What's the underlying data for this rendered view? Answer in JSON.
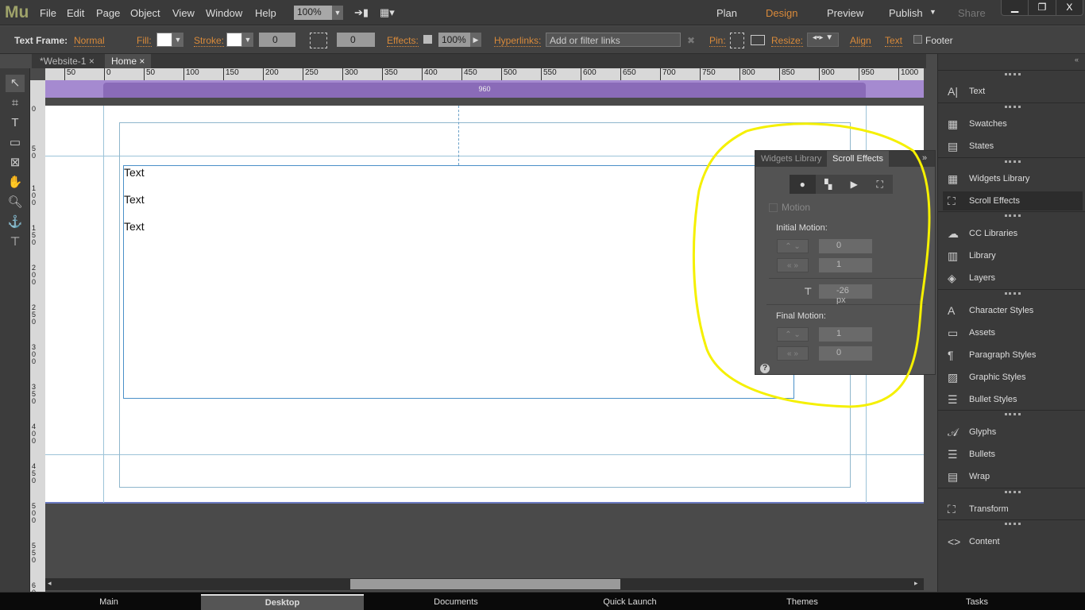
{
  "app": {
    "logo": "Mu",
    "menu": [
      "File",
      "Edit",
      "Page",
      "Object",
      "View",
      "Window",
      "Help"
    ],
    "zoom": "100%",
    "modes": [
      "Plan",
      "Design",
      "Preview",
      "Publish",
      "Share"
    ],
    "active_mode": "Design",
    "window_buttons": [
      "▁",
      "❐",
      "X"
    ]
  },
  "control": {
    "frame_label": "Text Frame:",
    "frame_style": "Normal",
    "fill": "Fill:",
    "stroke": "Stroke:",
    "stroke_width": "0",
    "corner": "0",
    "effects": "Effects:",
    "opacity": "100%",
    "hyperlinks": "Hyperlinks:",
    "links_placeholder": "Add or filter links",
    "pin": "Pin:",
    "resize": "Resize:",
    "align": "Align",
    "text": "Text",
    "footer": "Footer"
  },
  "tabs": [
    {
      "label": "*Website-1"
    },
    {
      "label": "Home"
    }
  ],
  "ruler": {
    "h": [
      "50",
      "0",
      "50",
      "100",
      "150",
      "200",
      "250",
      "300",
      "350",
      "400",
      "450",
      "500",
      "550",
      "600",
      "650",
      "700",
      "750",
      "800",
      "850",
      "900",
      "950",
      "1000"
    ],
    "v": [
      "0",
      "50",
      "100",
      "150",
      "200",
      "250",
      "300",
      "350",
      "400",
      "450",
      "500",
      "550",
      "600"
    ]
  },
  "canvas": {
    "band_width": "960",
    "texts": [
      "Text",
      "Text",
      "Text"
    ]
  },
  "scroll_effects": {
    "tabs": [
      "Widgets Library",
      "Scroll Effects"
    ],
    "motion": "Motion",
    "initial": "Initial Motion:",
    "initial_v": "0",
    "initial_h": "1",
    "offset": "-26 px",
    "final": "Final Motion:",
    "final_v": "1",
    "final_h": "0",
    "help": "?"
  },
  "right_panel": [
    {
      "label": "Text",
      "icon": "A|"
    },
    {
      "label": "Swatches",
      "icon": "▦"
    },
    {
      "label": "States",
      "icon": "▤"
    },
    {
      "label": "Widgets Library",
      "icon": "▦"
    },
    {
      "label": "Scroll Effects",
      "icon": "⛶",
      "active": true
    },
    {
      "label": "CC Libraries",
      "icon": "☁"
    },
    {
      "label": "Library",
      "icon": "▥"
    },
    {
      "label": "Layers",
      "icon": "◈"
    },
    {
      "label": "Character Styles",
      "icon": "A"
    },
    {
      "label": "Assets",
      "icon": "▭"
    },
    {
      "label": "Paragraph Styles",
      "icon": "¶"
    },
    {
      "label": "Graphic Styles",
      "icon": "▨"
    },
    {
      "label": "Bullet Styles",
      "icon": "☰"
    },
    {
      "label": "Glyphs",
      "icon": "𝒜"
    },
    {
      "label": "Bullets",
      "icon": "☰"
    },
    {
      "label": "Wrap",
      "icon": "▤"
    },
    {
      "label": "Transform",
      "icon": "⛶"
    },
    {
      "label": "Content",
      "icon": "<>"
    }
  ],
  "taskbar": [
    "Main",
    "Desktop",
    "Documents",
    "Quick Launch",
    "Themes",
    "Tasks"
  ],
  "taskbar_active": "Desktop",
  "colors": {
    "accent": "#d98a3a",
    "annotation": "#f5f000",
    "band": "#a58ad0"
  }
}
